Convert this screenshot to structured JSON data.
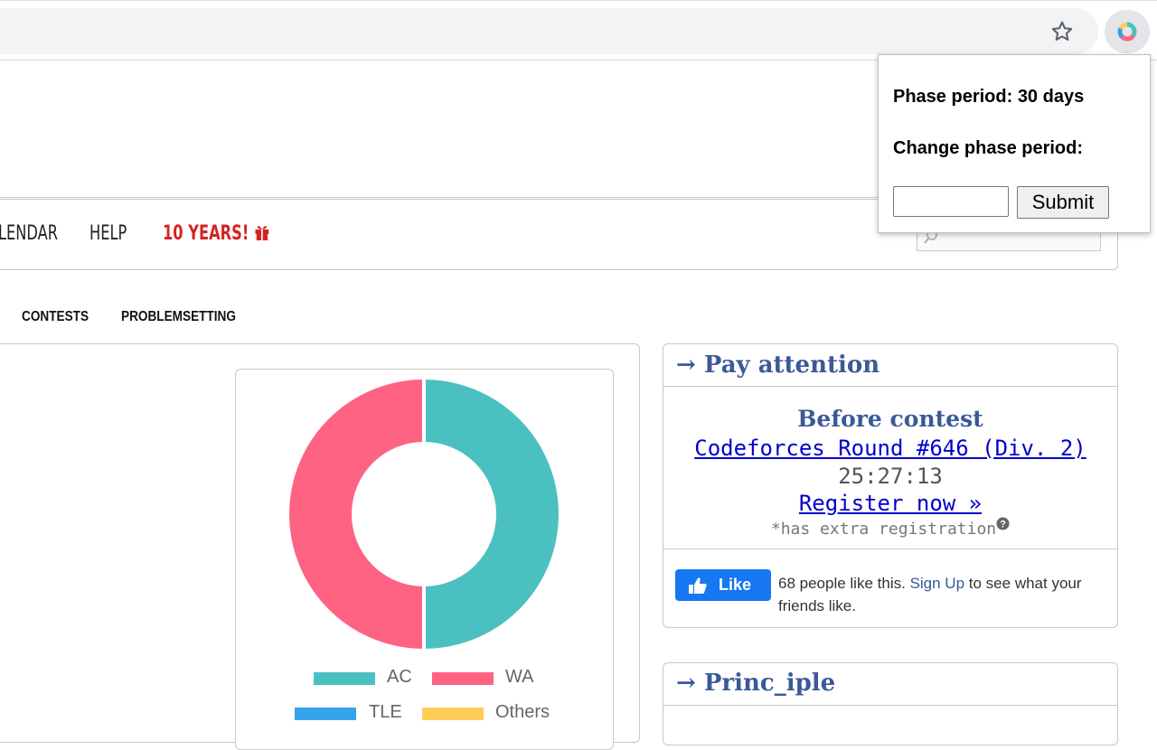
{
  "browser": {
    "bookmark_icon": "star-icon",
    "extension_icon": "pie-chart-extension-icon"
  },
  "nav": {
    "items": [
      "LENDAR",
      "HELP"
    ],
    "special": "10 YEARS!",
    "special_icon": "gift-icon",
    "special_color": "#d52323"
  },
  "subnav": {
    "items": [
      "CONTESTS",
      "PROBLEMSETTING"
    ]
  },
  "chart_data": {
    "type": "pie",
    "categories": [
      "AC",
      "WA",
      "TLE",
      "Others"
    ],
    "values": [
      50,
      50,
      0,
      0
    ],
    "colors": [
      "#4bc0c0",
      "#ff6384",
      "#36a2eb",
      "#ffcd56"
    ],
    "legend_position": "bottom"
  },
  "pay_attention": {
    "title": "→ Pay attention",
    "before_contest": "Before contest",
    "contest_link": "Codeforces Round #646 (Div. 2)",
    "countdown": "25:27:13",
    "register_link": "Register now »",
    "extra_note": "*has extra registration",
    "help_icon": "question-circle-icon"
  },
  "facebook": {
    "like_label": "Like",
    "text_before": "68 people like this.",
    "signup_link": "Sign Up",
    "text_after": "to see what your friends like."
  },
  "second_box": {
    "title": "→ Princ_iple"
  },
  "popup": {
    "phase_period": "Phase period: 30 days",
    "change_label": "Change phase period:",
    "input_value": "",
    "submit_label": "Submit"
  }
}
